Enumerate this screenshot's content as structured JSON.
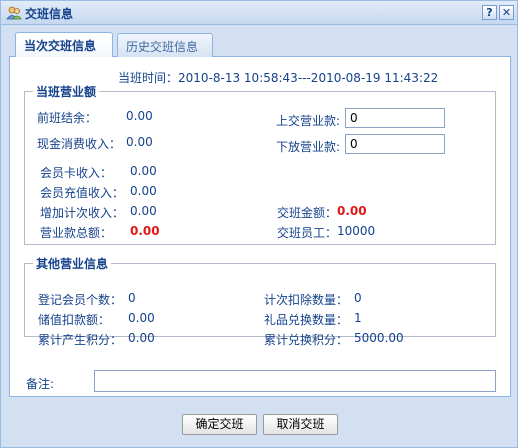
{
  "window": {
    "title": "交班信息",
    "help_label": "?",
    "close_label": "✕"
  },
  "tabs": [
    {
      "label": "当次交班信息",
      "active": true
    },
    {
      "label": "历史交班信息",
      "active": false
    }
  ],
  "shift_time": "当班时间：2010-8-13 10:58:43---2010-08-19 11:43:22",
  "revenue": {
    "legend": "当班营业额",
    "prev_balance_label": "前班结余：",
    "prev_balance_value": "0.00",
    "cash_label": "现金消费收入：",
    "cash_value": "0.00",
    "card_label": "会员卡收入：",
    "card_value": "0.00",
    "recharge_label": "会员充值收入：",
    "recharge_value": "0.00",
    "count_label": "增加计次收入：",
    "count_value": "0.00",
    "total_label": "营业款总额：",
    "total_value": "0.00",
    "submit_label": "上交营业款:",
    "submit_value": "0",
    "release_label": "下放营业款:",
    "release_value": "0",
    "handover_amount_label": "交班金额：",
    "handover_amount_value": "0.00",
    "handover_staff_label": "交班员工：",
    "handover_staff_value": "10000"
  },
  "other": {
    "legend": "其他营业信息",
    "members_label": "登记会员个数：",
    "members_value": "0",
    "stored_label": "储值扣款额：",
    "stored_value": "0.00",
    "points_label": "累计产生积分：",
    "points_value": "0.00",
    "count_deduct_label": "计次扣除数量：",
    "count_deduct_value": "0",
    "gift_label": "礼品兑换数量：",
    "gift_value": "1",
    "redeem_label": "累计兑换积分：",
    "redeem_value": "5000.00"
  },
  "remark": {
    "label": "备注:",
    "value": ""
  },
  "buttons": {
    "confirm": "确定交班",
    "cancel": "取消交班"
  },
  "colors": {
    "accent": "#15428b",
    "highlight": "#e01818",
    "background": "#d2e0f1"
  }
}
